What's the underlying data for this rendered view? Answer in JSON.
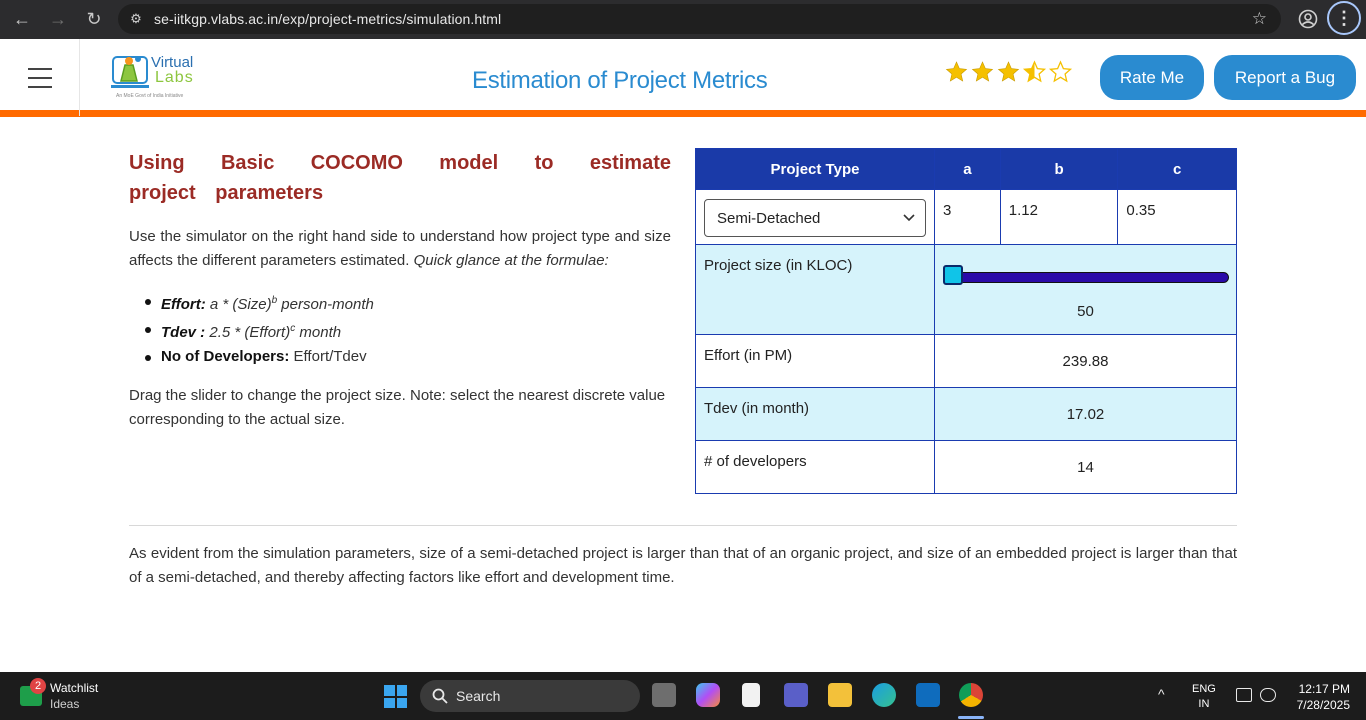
{
  "browser": {
    "url": "se-iitkgp.vlabs.ac.in/exp/project-metrics/simulation.html"
  },
  "header": {
    "logo_text_top": "Virtual",
    "logo_text_bottom": "Labs",
    "logo_tagline": "An MoE Govt of India Initiative",
    "title": "Estimation of Project Metrics",
    "rating": {
      "value": 3.5,
      "max": 5
    },
    "rate_button": "Rate Me",
    "bug_button": "Report a Bug"
  },
  "content": {
    "section_title": "Using Basic COCOMO model to estimate project parameters",
    "intro_plain": "Use the simulator on the right hand side to understand how project type and size affects the different parameters estimated.",
    "intro_italic": "Quick glance at the formulae:",
    "formulas": [
      {
        "name": "Effort:",
        "expr": "a * (Size)",
        "sup": "b",
        "tail": " person-month"
      },
      {
        "name": "Tdev :",
        "expr": "2.5 * (Effort)",
        "sup": "c",
        "tail": " month"
      },
      {
        "name": "No of Developers:",
        "expr": "Effort/Tdev"
      }
    ],
    "note": "Drag the slider to change the project size. Note: select the nearest discrete value corresponding to the actual size.",
    "conclusion": "As evident from the simulation parameters, size of a semi-detached project is larger than that of an organic project, and size of an embedded project is larger than that of a semi-detached, and thereby affecting factors like effort and development time."
  },
  "simulator": {
    "headers": [
      "Project Type",
      "a",
      "b",
      "c"
    ],
    "project_type": "Semi-Detached",
    "a": "3",
    "b": "1.12",
    "c": "0.35",
    "size_label": "Project size (in KLOC)",
    "size_value": "50",
    "effort_label": "Effort (in PM)",
    "effort_value": "239.88",
    "tdev_label": "Tdev (in month)",
    "tdev_value": "17.02",
    "dev_label": "# of developers",
    "dev_value": "14"
  },
  "taskbar": {
    "widget_title": "Watchlist",
    "widget_sub": "Ideas",
    "widget_badge": "2",
    "search": "Search",
    "lang_top": "ENG",
    "lang_bottom": "IN",
    "time": "12:17 PM",
    "date": "7/28/2025"
  }
}
